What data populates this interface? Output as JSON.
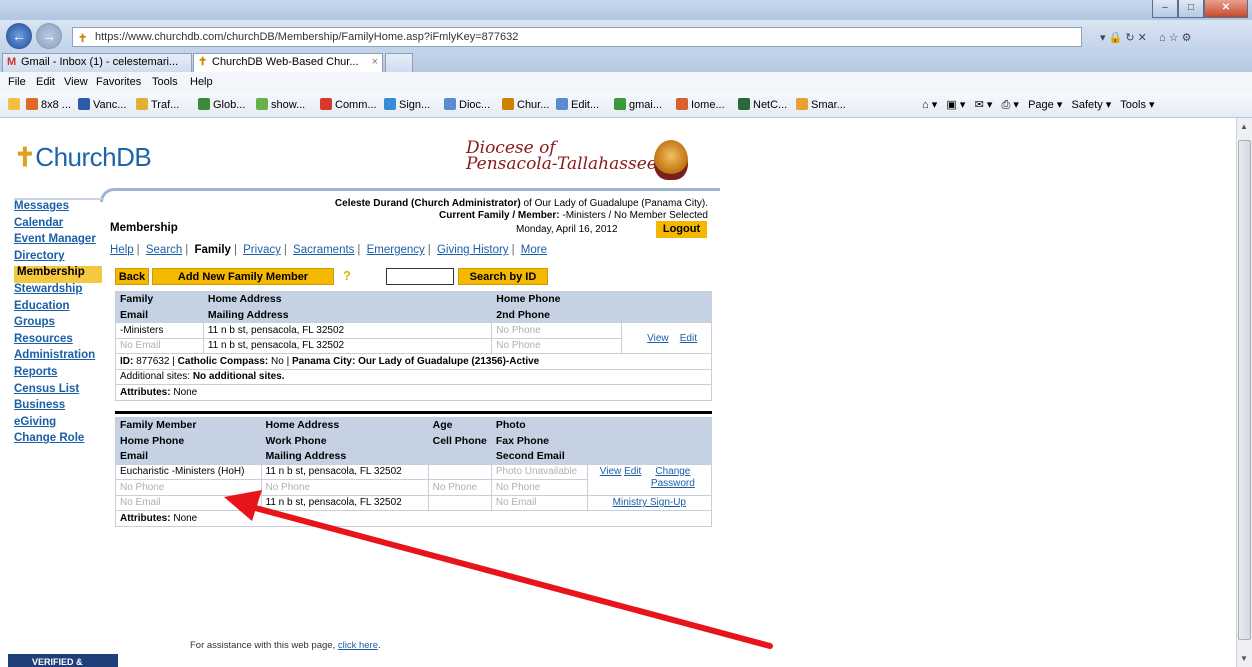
{
  "browser": {
    "url": "https://www.churchdb.com/churchDB/Membership/FamilyHome.asp?iFmlyKey=877632",
    "tabs": [
      {
        "label": "Gmail - Inbox (1) - celestemari..."
      },
      {
        "label": "ChurchDB Web-Based Chur..."
      }
    ],
    "menu": [
      "File",
      "Edit",
      "View",
      "Favorites",
      "Tools",
      "Help"
    ],
    "favorites": [
      "8x8 ...",
      "Vanc...",
      "Traf...",
      "Glob...",
      "show...",
      "Comm...",
      "Sign...",
      "Dioc...",
      "Chur...",
      "Edit...",
      "gmai...",
      "Iome...",
      "NetC...",
      "Smar..."
    ],
    "command_bar": {
      "page": "Page ▾",
      "safety": "Safety ▾",
      "tools": "Tools ▾"
    }
  },
  "site": {
    "logo": "ChurchDB",
    "diocese_line1": "Diocese of",
    "diocese_line2": "Pensacola-Tallahassee"
  },
  "leftnav": [
    "Messages",
    "Calendar",
    "Event Manager",
    "Directory",
    "Membership",
    "Stewardship",
    "Education",
    "Groups",
    "Resources",
    "Administration",
    "Reports",
    "Census List",
    "Business",
    "eGiving",
    "Change Role"
  ],
  "header": {
    "user_line_bold": "Celeste Durand (Church Administrator)",
    "user_line_rest": " of Our Lady of Guadalupe (Panama City).",
    "current_label": "Current Family / Member:",
    "current_value": " -Ministers / No Member Selected",
    "section": "Membership",
    "date": "Monday, April 16, 2012",
    "logout": "Logout"
  },
  "subnav": {
    "help": "Help",
    "search": "Search",
    "family": "Family",
    "privacy": "Privacy",
    "sacraments": "Sacraments",
    "emergency": "Emergency",
    "giving": "Giving History",
    "more": "More"
  },
  "actions": {
    "back": "Back",
    "add_member": "Add New Family Member",
    "help_mark": "?",
    "search_id": "Search by ID"
  },
  "family_table": {
    "hdr1": [
      "Family",
      "Home Address",
      "Home Phone"
    ],
    "hdr2": [
      "Email",
      "Mailing Address",
      "2nd Phone"
    ],
    "row1": [
      "-Ministers",
      "11 n b st, pensacola, FL  32502",
      "No Phone"
    ],
    "row2": [
      "No Email",
      "11 n b st, pensacola, FL  32502",
      "No Phone"
    ],
    "view": "View",
    "edit": "Edit",
    "id_label": "ID:",
    "id_value": " 877632 | ",
    "compass_label": "Catholic Compass:",
    "compass_value": " No | ",
    "parish": "Panama City: Our Lady of Guadalupe (21356)-Active",
    "sites_label": "Additional sites: ",
    "sites_value": "No additional sites.",
    "attr_label": "Attributes:",
    "attr_value": " None"
  },
  "member_table": {
    "hdr1": [
      "Family Member",
      "Home Address",
      "Age",
      "Photo"
    ],
    "hdr2": [
      "Home Phone",
      "Work Phone",
      "Cell Phone",
      "Fax Phone"
    ],
    "hdr3": [
      "Email",
      "Mailing Address",
      "",
      "Second Email"
    ],
    "row1": [
      "Eucharistic -Ministers (HoH)",
      "11 n b st, pensacola, FL  32502",
      "",
      "Photo Unavailable"
    ],
    "row2": [
      "No Phone",
      "No Phone",
      "No Phone",
      "No Phone"
    ],
    "row3": [
      "No Email",
      "11 n b st, pensacola, FL  32502",
      "",
      "No Email"
    ],
    "view": "View",
    "edit": "Edit",
    "change_password": "Change Password",
    "ministry": "Ministry Sign-Up",
    "attr_label": "Attributes:",
    "attr_value": " None"
  },
  "footer": {
    "assist": "For assistance with this web page, ",
    "click": "click here",
    "verified": "VERIFIED & SECURED"
  },
  "colors": {
    "accent": "#f5b800",
    "link": "#1a5fa8",
    "header_bg": "#c4d2e4",
    "arrow": "#e8141b"
  }
}
